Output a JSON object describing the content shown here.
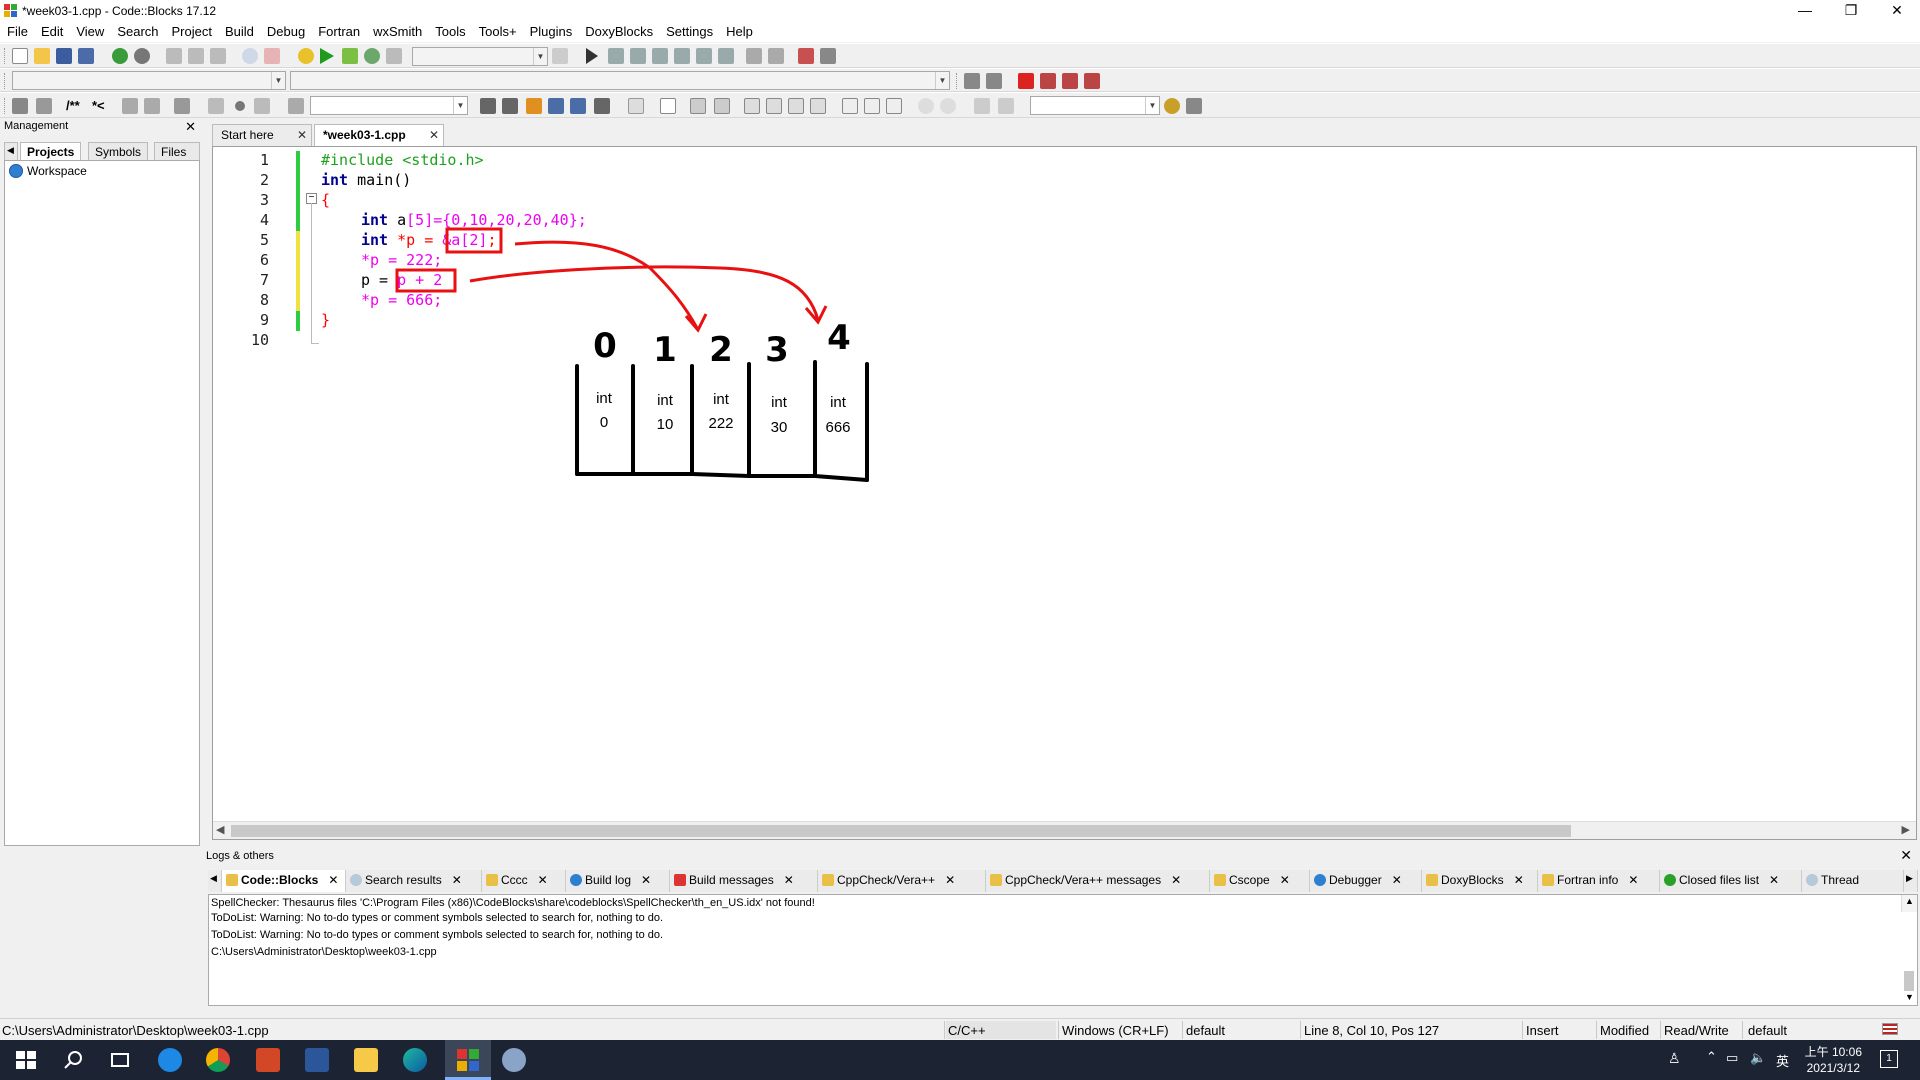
{
  "window": {
    "title": "*week03-1.cpp - Code::Blocks 17.12",
    "minimize": "—",
    "restore": "❐",
    "close": "✕"
  },
  "menu": [
    "File",
    "Edit",
    "View",
    "Search",
    "Project",
    "Build",
    "Debug",
    "Fortran",
    "wxSmith",
    "Tools",
    "Tools+",
    "Plugins",
    "DoxyBlocks",
    "Settings",
    "Help"
  ],
  "toolbar": {
    "comment_block": "/**",
    "comment_line": "*<"
  },
  "management": {
    "title": "Management",
    "close": "✕",
    "tabs": [
      "Projects",
      "Symbols",
      "Files"
    ],
    "tree_root": "Workspace"
  },
  "editor": {
    "tabs": [
      {
        "label": "Start here",
        "active": false
      },
      {
        "label": "*week03-1.cpp",
        "active": true
      }
    ],
    "line_numbers": [
      "1",
      "2",
      "3",
      "4",
      "5",
      "6",
      "7",
      "8",
      "9",
      "10"
    ],
    "code": {
      "l1": "#include <stdio.h>",
      "l2_kw": "int",
      "l2_rest": " main()",
      "l3": "{",
      "l4_kw": "int",
      "l4_id": " a",
      "l4_rest": "[5]={0,10,20,20,40};",
      "l5_kw": "int",
      "l5_rest": " *p = ",
      "l5_box": "&a[2]",
      "l5_end": ";",
      "l6": "*p = 222;",
      "l7_a": "p = ",
      "l7_box": "p + 2",
      "l8": "*p = 666;",
      "l9": "}"
    }
  },
  "annotation": {
    "indices": [
      "0",
      "1",
      "2",
      "3",
      "4"
    ],
    "cells": [
      {
        "type": "int",
        "value": "0"
      },
      {
        "type": "int",
        "value": "10"
      },
      {
        "type": "int",
        "value": "222"
      },
      {
        "type": "int",
        "value": "30"
      },
      {
        "type": "int",
        "value": "666"
      }
    ],
    "ink_color": "#e81010"
  },
  "logs": {
    "title": "Logs & others",
    "tabs": [
      "Code::Blocks",
      "Search results",
      "Cccc",
      "Build log",
      "Build messages",
      "CppCheck/Vera++",
      "CppCheck/Vera++ messages",
      "Cscope",
      "Debugger",
      "DoxyBlocks",
      "Fortran info",
      "Closed files list",
      "Thread"
    ],
    "lines": [
      "SpellChecker: Thesaurus files 'C:\\Program Files (x86)\\CodeBlocks\\share\\codeblocks\\SpellChecker\\th_en_US.idx' not found!",
      "ToDoList: Warning: No to-do types or comment symbols selected to search for, nothing to do.",
      "ToDoList: Warning: No to-do types or comment symbols selected to search for, nothing to do.",
      "C:\\Users\\Administrator\\Desktop\\week03-1.cpp"
    ]
  },
  "status": {
    "path": "C:\\Users\\Administrator\\Desktop\\week03-1.cpp",
    "language": "C/C++",
    "eol": "Windows (CR+LF)",
    "encoding": "default",
    "position": "Line 8, Col 10, Pos 127",
    "mode": "Insert",
    "modified": "Modified",
    "access": "Read/Write",
    "profile": "default"
  },
  "taskbar": {
    "time": "上午 10:06",
    "date": "2021/3/12",
    "ime": "英",
    "notifications": "1"
  }
}
